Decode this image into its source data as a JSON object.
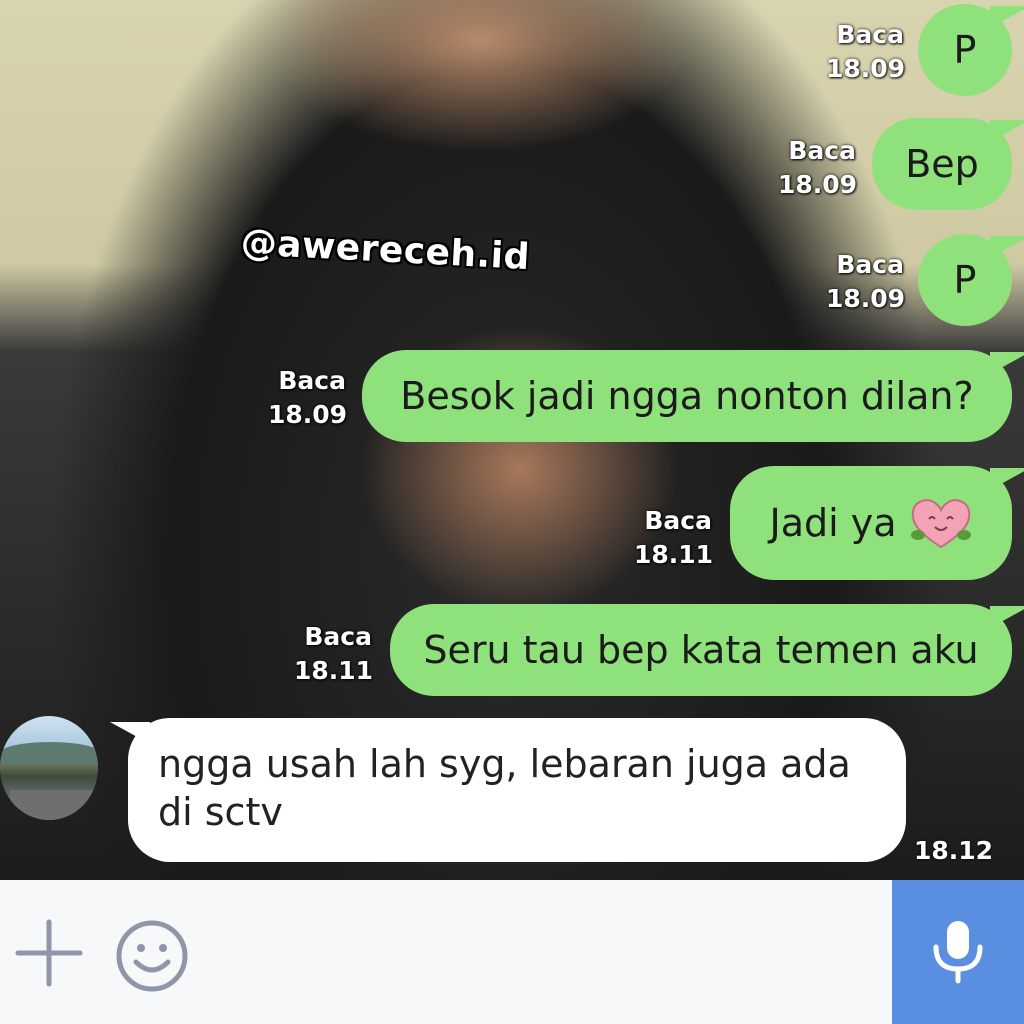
{
  "watermark": "@awereceh.id",
  "messages_sent": [
    {
      "text": "P",
      "status": "Baca",
      "time": "18.09"
    },
    {
      "text": "Bep",
      "status": "Baca",
      "time": "18.09"
    },
    {
      "text": "P",
      "status": "Baca",
      "time": "18.09"
    },
    {
      "text": "Besok jadi ngga nonton dilan?",
      "status": "Baca",
      "time": "18.09"
    },
    {
      "text": "Jadi ya",
      "status": "Baca",
      "time": "18.11",
      "sticker": "heart-emoji-icon"
    },
    {
      "text": "Seru tau bep kata temen aku",
      "status": "Baca",
      "time": "18.11"
    }
  ],
  "message_received": {
    "text": "ngga usah lah syg, lebaran juga ada di sctv",
    "time": "18.12"
  },
  "input_bar": {
    "icons": [
      "plus-icon",
      "smiley-icon",
      "microphone-icon"
    ]
  },
  "colors": {
    "sent_bubble": "#8fe27b",
    "received_bubble": "#ffffff",
    "mic_button": "#5a8ee0",
    "icon_gray": "#8e96a8"
  }
}
